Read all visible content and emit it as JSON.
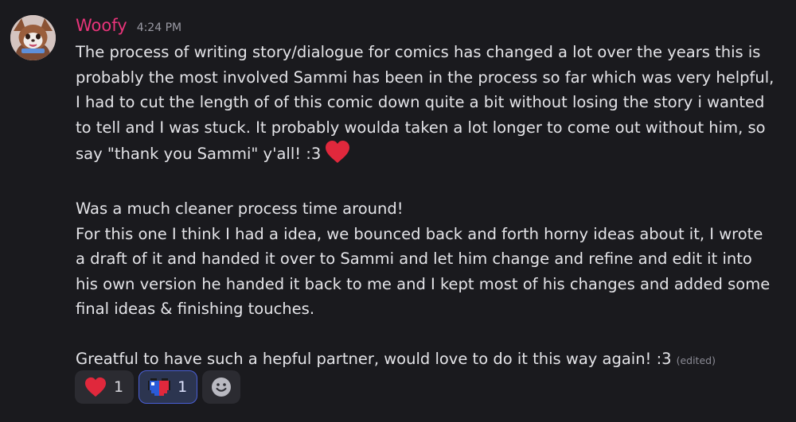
{
  "message": {
    "author": {
      "name": "Woofy",
      "name_color": "#e8347a",
      "avatar": "fox-girl-avatar"
    },
    "timestamp": "4:24 PM",
    "paragraphs": [
      {
        "lines": [
          "The process of writing story/dialogue for comics has changed a lot over the years this is",
          "probably the most involved Sammi has been in the process so far which was very helpful,",
          "I had to cut the length of of this comic down quite a bit without losing the story i wanted",
          "to tell and I was stuck. It probably woulda taken a lot longer to come out without him, so",
          "say \"thank you Sammi\" y'all! :3"
        ],
        "trailing_emoji": "red-heart"
      },
      {
        "lines": [
          "Was a much cleaner process time around!",
          "For this one I think I had a idea, we bounced back and forth horny ideas about it, I wrote",
          "a draft of it and handed it over to Sammi and let him change and refine and edit it into",
          "his own version he handed it back to me and I kept most of his changes and added some",
          "final ideas & finishing touches."
        ]
      },
      {
        "lines": [
          "Greatful to have  such a hepful partner, would love to do it this way again! :3"
        ]
      }
    ],
    "edited_label": "(edited)"
  },
  "reactions": [
    {
      "emoji": "red-heart",
      "count": "1",
      "selected": false
    },
    {
      "emoji": "pixel-heart",
      "count": "1",
      "selected": true
    }
  ],
  "add_reaction": {
    "icon": "smiley-face-icon"
  },
  "colors": {
    "background": "#1a1a1e",
    "accent": "#4a5fd6",
    "heart": "#e0283c"
  }
}
